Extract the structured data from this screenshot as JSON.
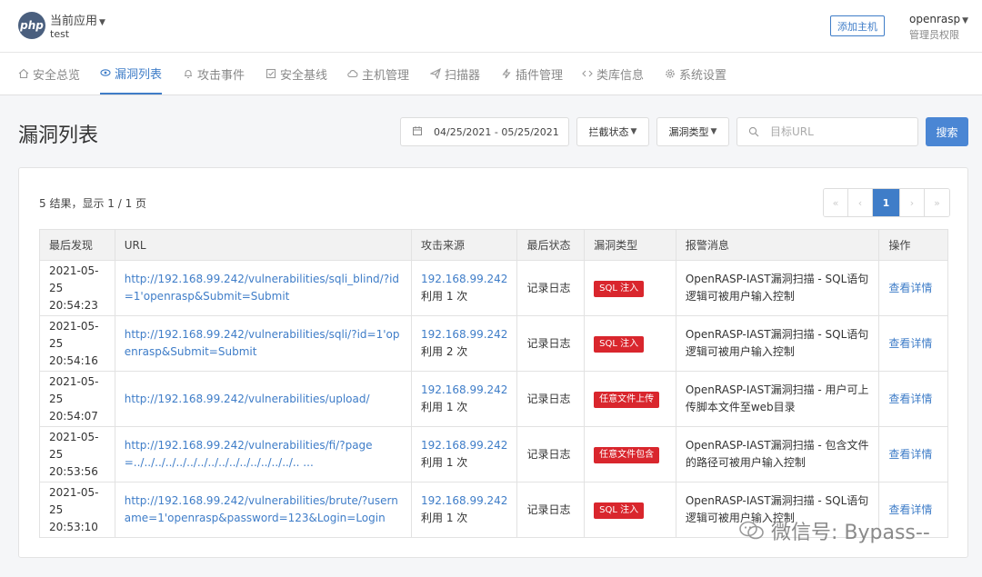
{
  "header": {
    "logo_text": "php",
    "app_name": "当前应用",
    "app_sub": "test",
    "add_host": "添加主机",
    "user": "openrasp",
    "user_role": "管理员权限"
  },
  "nav": [
    {
      "label": "安全总览",
      "icon": "home-icon"
    },
    {
      "label": "漏洞列表",
      "icon": "eye-icon",
      "active": true
    },
    {
      "label": "攻击事件",
      "icon": "bell-icon"
    },
    {
      "label": "安全基线",
      "icon": "checkbox-icon"
    },
    {
      "label": "主机管理",
      "icon": "cloud-icon"
    },
    {
      "label": "扫描器",
      "icon": "send-icon"
    },
    {
      "label": "插件管理",
      "icon": "bolt-icon"
    },
    {
      "label": "类库信息",
      "icon": "code-icon"
    },
    {
      "label": "系统设置",
      "icon": "gear-icon"
    }
  ],
  "page_title": "漏洞列表",
  "filters": {
    "date_range": "04/25/2021 - 05/25/2021",
    "block_status": "拦截状态",
    "vuln_type": "漏洞类型",
    "target_placeholder": "目标URL",
    "search_label": "搜索"
  },
  "result_info": "5 结果，显示 1 / 1 页",
  "pager": {
    "first": "«",
    "prev": "‹",
    "current": "1",
    "next": "›",
    "last": "»"
  },
  "table": {
    "headers": [
      "最后发现",
      "URL",
      "攻击来源",
      "最后状态",
      "漏洞类型",
      "报警消息",
      "操作"
    ],
    "rows": [
      {
        "date": "2021-05-25",
        "time": "20:54:23",
        "url": "http://192.168.99.242/vulnerabilities/sqli_blind/?id=1'openrasp&Submit=Submit",
        "source_ip": "192.168.99.242",
        "source_count": "利用 1 次",
        "status": "记录日志",
        "type": "SQL 注入",
        "message": "OpenRASP-IAST漏洞扫描 - SQL语句逻辑可被用户输入控制",
        "action": "查看详情"
      },
      {
        "date": "2021-05-25",
        "time": "20:54:16",
        "url": "http://192.168.99.242/vulnerabilities/sqli/?id=1'openrasp&Submit=Submit",
        "source_ip": "192.168.99.242",
        "source_count": "利用 2 次",
        "status": "记录日志",
        "type": "SQL 注入",
        "message": "OpenRASP-IAST漏洞扫描 - SQL语句逻辑可被用户输入控制",
        "action": "查看详情"
      },
      {
        "date": "2021-05-25",
        "time": "20:54:07",
        "url": "http://192.168.99.242/vulnerabilities/upload/",
        "source_ip": "192.168.99.242",
        "source_count": "利用 1 次",
        "status": "记录日志",
        "type": "任意文件上传",
        "message": "OpenRASP-IAST漏洞扫描 - 用户可上传脚本文件至web目录",
        "action": "查看详情"
      },
      {
        "date": "2021-05-25",
        "time": "20:53:56",
        "url": "http://192.168.99.242/vulnerabilities/fi/?page=../../../../../../../../../../../../../../../.. ...",
        "source_ip": "192.168.99.242",
        "source_count": "利用 1 次",
        "status": "记录日志",
        "type": "任意文件包含",
        "message": "OpenRASP-IAST漏洞扫描 - 包含文件的路径可被用户输入控制",
        "action": "查看详情"
      },
      {
        "date": "2021-05-25",
        "time": "20:53:10",
        "url": "http://192.168.99.242/vulnerabilities/brute/?username=1'openrasp&password=123&Login=Login",
        "source_ip": "192.168.99.242",
        "source_count": "利用 1 次",
        "status": "记录日志",
        "type": "SQL 注入",
        "message": "OpenRASP-IAST漏洞扫描 - SQL语句逻辑可被用户输入控制",
        "action": "查看详情"
      }
    ]
  },
  "watermark": "微信号: Bypass--",
  "colors": {
    "accent": "#3f7dc8",
    "badge": "#d9262d"
  }
}
